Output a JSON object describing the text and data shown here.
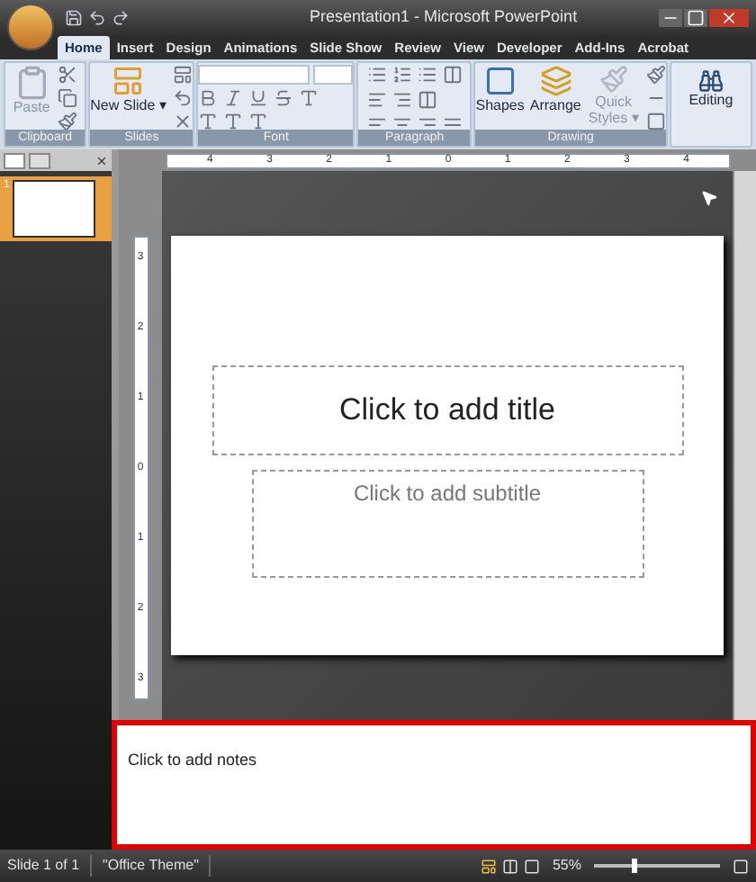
{
  "window": {
    "title": "Presentation1 - Microsoft PowerPoint"
  },
  "tabs": [
    {
      "label": "Home",
      "selected": true
    },
    {
      "label": "Insert",
      "selected": false
    },
    {
      "label": "Design",
      "selected": false
    },
    {
      "label": "Animations",
      "selected": false
    },
    {
      "label": "Slide Show",
      "selected": false
    },
    {
      "label": "Review",
      "selected": false
    },
    {
      "label": "View",
      "selected": false
    },
    {
      "label": "Developer",
      "selected": false
    },
    {
      "label": "Add-Ins",
      "selected": false
    },
    {
      "label": "Acrobat",
      "selected": false
    }
  ],
  "ribbon": {
    "groups": [
      {
        "kind": "clipboard",
        "name": "Clipboard",
        "buttons": [
          "Paste"
        ]
      },
      {
        "kind": "slides",
        "name": "Slides",
        "buttons": [
          "New Slide ▾"
        ]
      },
      {
        "kind": "font",
        "name": "Font"
      },
      {
        "kind": "paragraph",
        "name": "Paragraph"
      },
      {
        "kind": "drawing",
        "name": "Drawing",
        "buttons": [
          "Shapes",
          "Arrange",
          "Quick Styles ▾"
        ]
      },
      {
        "kind": "editing",
        "buttons": [
          "Editing"
        ]
      }
    ]
  },
  "slides_pane": {
    "thumbnails": [
      {
        "number": "1",
        "selected": true
      }
    ]
  },
  "horizontal_ruler": [
    "4",
    "3",
    "2",
    "1",
    "0",
    "1",
    "2",
    "3",
    "4"
  ],
  "vertical_ruler": [
    "3",
    "2",
    "1",
    "0",
    "1",
    "2",
    "3"
  ],
  "slide": {
    "title_placeholder": "Click to add title",
    "subtitle_placeholder": "Click to add subtitle"
  },
  "notes": {
    "placeholder": "Click to add notes",
    "highlighted": true
  },
  "status_bar": {
    "slide": "Slide 1 of 1",
    "theme": "\"Office Theme\"",
    "zoom": "55%",
    "level": 0.3
  }
}
